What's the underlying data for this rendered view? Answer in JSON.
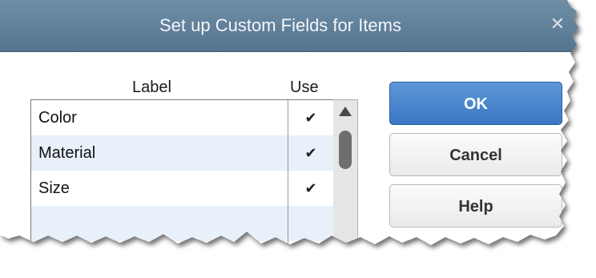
{
  "dialog": {
    "title": "Set up Custom Fields for Items",
    "close_icon": "close-icon"
  },
  "list": {
    "header_label": "Label",
    "header_use": "Use",
    "rows": [
      {
        "label": "Color",
        "use": "✔"
      },
      {
        "label": "Material",
        "use": "✔"
      },
      {
        "label": "Size",
        "use": "✔"
      },
      {
        "label": "",
        "use": ""
      }
    ]
  },
  "buttons": {
    "ok": "OK",
    "cancel": "Cancel",
    "help": "Help"
  },
  "colors": {
    "titlebar": "#5f7f99",
    "ok_button": "#4a86cf",
    "alt_row": "#e8f0fa"
  }
}
